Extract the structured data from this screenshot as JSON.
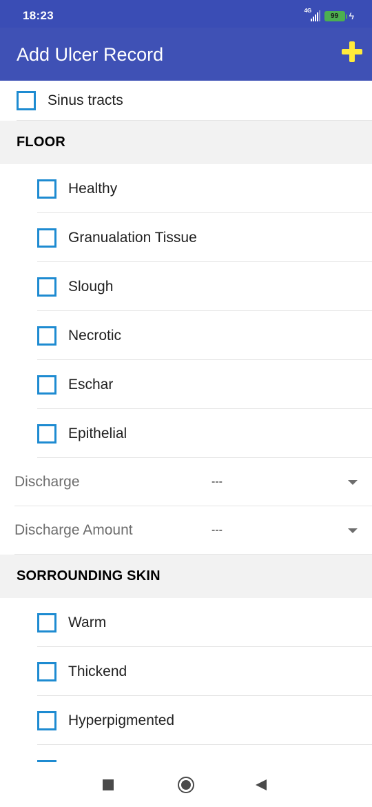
{
  "status_bar": {
    "time": "18:23",
    "network": "4G",
    "battery": "99"
  },
  "app_bar": {
    "title": "Add Ulcer Record",
    "action_icon": "plus-icon",
    "action_color": "#ffeb3b",
    "bar_color": "#3f51b5"
  },
  "top_item": {
    "label": "Sinus tracts",
    "checked": false
  },
  "floor": {
    "header": "FLOOR",
    "items": [
      {
        "label": "Healthy",
        "checked": false
      },
      {
        "label": "Granualation Tissue",
        "checked": false
      },
      {
        "label": "Slough",
        "checked": false
      },
      {
        "label": "Necrotic",
        "checked": false
      },
      {
        "label": "Eschar",
        "checked": false
      },
      {
        "label": "Epithelial",
        "checked": false
      }
    ]
  },
  "discharge": {
    "label": "Discharge",
    "value": "---"
  },
  "discharge_amount": {
    "label": "Discharge Amount",
    "value": "---"
  },
  "surrounding_skin": {
    "header": "SORROUNDING SKIN",
    "items": [
      {
        "label": "Warm",
        "checked": false
      },
      {
        "label": "Thickend",
        "checked": false
      },
      {
        "label": "Hyperpigmented",
        "checked": false
      }
    ]
  },
  "nav_bar": {
    "icons": [
      "recents-icon",
      "home-icon",
      "back-icon"
    ]
  }
}
